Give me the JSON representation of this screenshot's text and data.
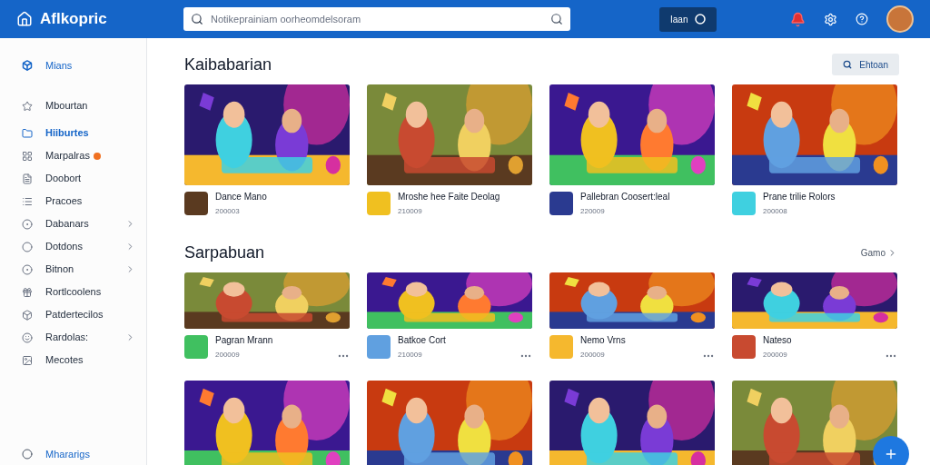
{
  "header": {
    "logo_text": "Aflkopric",
    "search": {
      "placeholder": "Notikeprainiam oorheomdelsoram"
    },
    "button": "Iaan"
  },
  "sidebar": {
    "top_item": "Mians",
    "items": [
      {
        "label": "Mbourtan",
        "selected": false,
        "badge": false,
        "submenu": false
      },
      {
        "label": "Hiiburtes",
        "selected": true,
        "badge": false,
        "submenu": false
      },
      {
        "label": "Marpalras",
        "selected": false,
        "badge": true,
        "submenu": false
      },
      {
        "label": "Doobort",
        "selected": false,
        "badge": false,
        "submenu": false
      },
      {
        "label": "Pracoes",
        "selected": false,
        "badge": false,
        "submenu": false
      },
      {
        "label": "Dabanars",
        "selected": false,
        "badge": false,
        "submenu": true
      },
      {
        "label": "Dotdons",
        "selected": false,
        "badge": false,
        "submenu": true
      },
      {
        "label": "Bitnon",
        "selected": false,
        "badge": false,
        "submenu": true
      },
      {
        "label": "Rortlcoolens",
        "selected": false,
        "badge": false,
        "submenu": false
      },
      {
        "label": "Patdertecilos",
        "selected": false,
        "badge": false,
        "submenu": false
      },
      {
        "label": "Rardolas:",
        "selected": false,
        "badge": false,
        "submenu": true
      },
      {
        "label": "Mecotes",
        "selected": false,
        "badge": false,
        "submenu": false
      }
    ],
    "footer_item": "Mhararigs"
  },
  "sections": [
    {
      "title": "Kaibabarian",
      "action": {
        "kind": "button",
        "label": "Ehtoan"
      },
      "items": [
        {
          "title": "Dance Mano",
          "subtitle": "200003",
          "menu": false
        },
        {
          "title": "Mroshe hee Faite Deolag",
          "subtitle": "210009",
          "menu": false
        },
        {
          "title": "Pallebran Coosert:leal",
          "subtitle": "220009",
          "menu": false
        },
        {
          "title": "Prane trilie Rolors",
          "subtitle": "200008",
          "menu": false
        }
      ]
    },
    {
      "title": "Sarpabuan",
      "action": {
        "kind": "link",
        "label": "Gamo"
      },
      "items": [
        {
          "title": "Pagran Mrann",
          "subtitle": "200009",
          "menu": true
        },
        {
          "title": "Batkoe Cort",
          "subtitle": "210009",
          "menu": true
        },
        {
          "title": "Nemo Vrns",
          "subtitle": "200009",
          "menu": true
        },
        {
          "title": "Nateso",
          "subtitle": "200009",
          "menu": true
        }
      ]
    },
    {
      "items": [
        {
          "kind": "picture"
        },
        {
          "kind": "picture"
        },
        {
          "kind": "picture"
        },
        {
          "kind": "picture"
        }
      ]
    }
  ]
}
